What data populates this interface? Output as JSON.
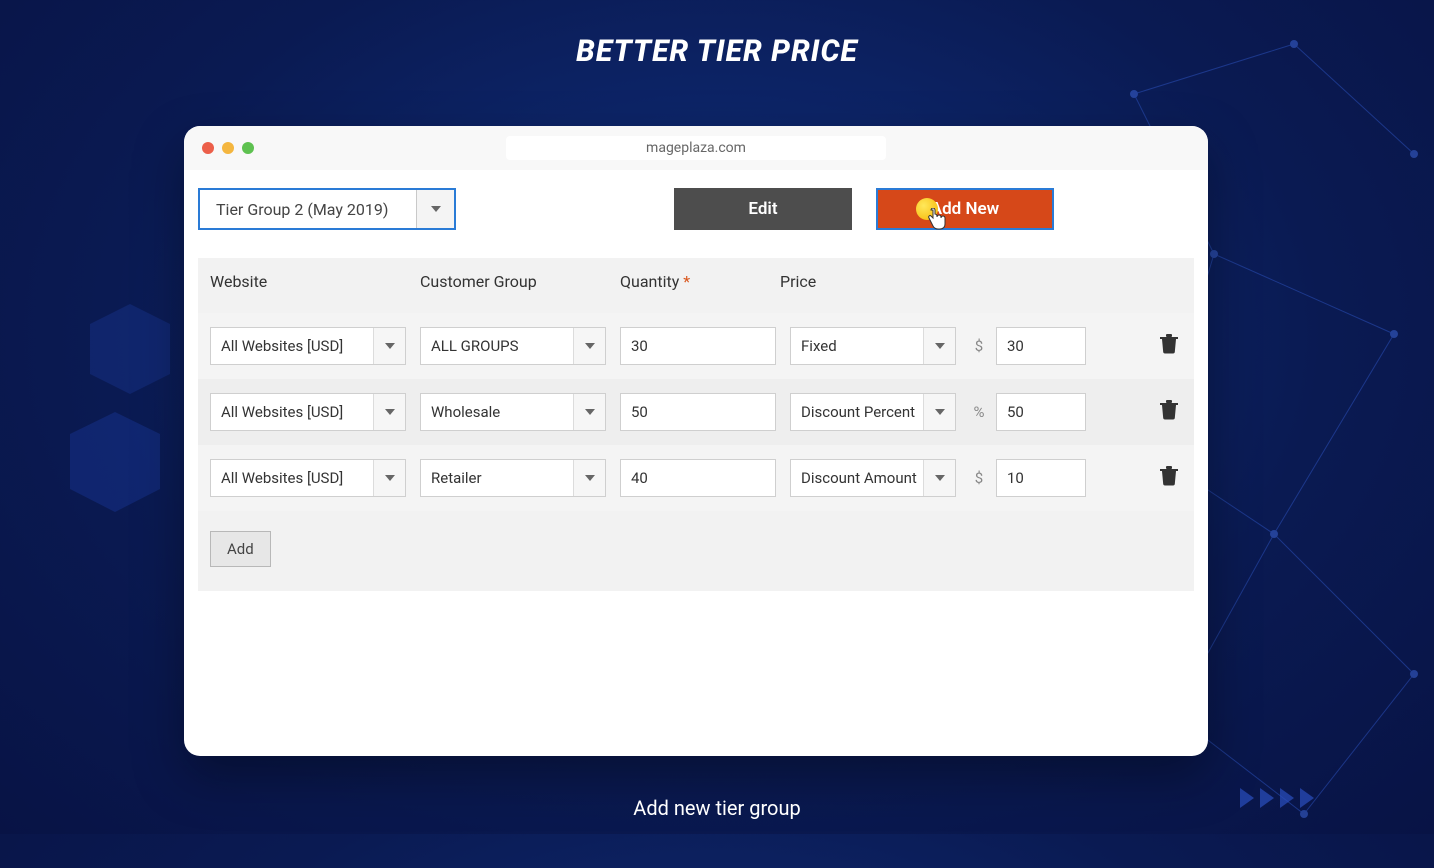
{
  "page_title": "BETTER TIER PRICE",
  "url": "mageplaza.com",
  "tier_group_select": "Tier Group 2 (May 2019)",
  "buttons": {
    "edit": "Edit",
    "add_new": "Add New",
    "add_row": "Add"
  },
  "columns": {
    "website": "Website",
    "customer_group": "Customer Group",
    "quantity": "Quantity",
    "quantity_required": "*",
    "price": "Price"
  },
  "rows": [
    {
      "website": "All Websites [USD]",
      "customer_group": "ALL GROUPS",
      "quantity": "30",
      "price_type": "Fixed",
      "price_symbol": "$",
      "price_value": "30"
    },
    {
      "website": "All Websites [USD]",
      "customer_group": "Wholesale",
      "quantity": "50",
      "price_type": "Discount Percent",
      "price_symbol": "%",
      "price_value": "50"
    },
    {
      "website": "All Websites [USD]",
      "customer_group": "Retailer",
      "quantity": "40",
      "price_type": "Discount Amount",
      "price_symbol": "$",
      "price_value": "10"
    }
  ],
  "caption": "Add new tier group"
}
